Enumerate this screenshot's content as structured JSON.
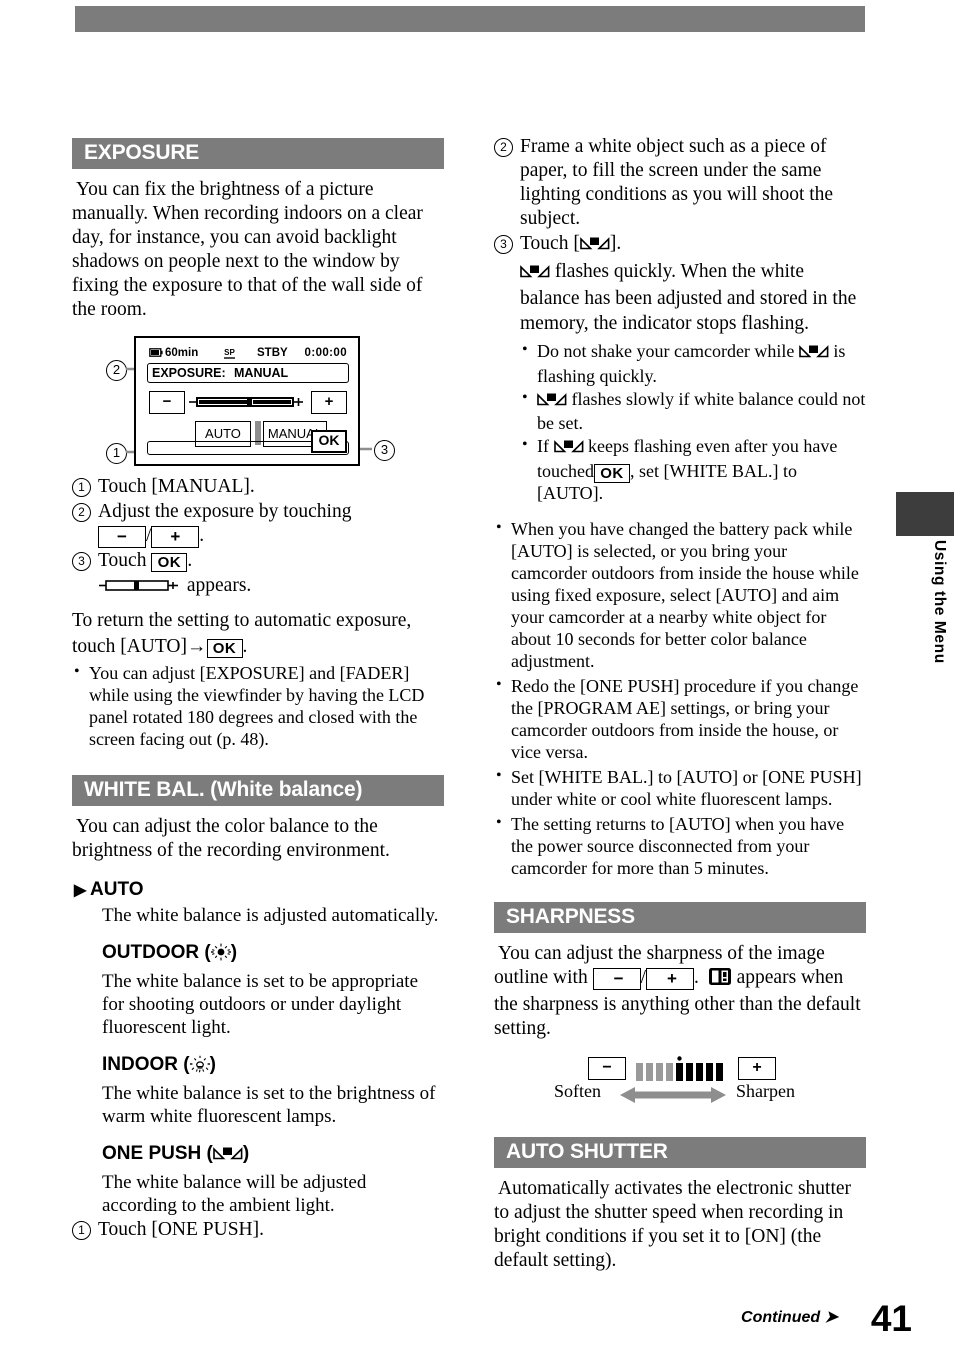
{
  "page": {
    "number": "41",
    "continued_label": "Continued",
    "side_tab_label": "Using the Menu"
  },
  "sections": {
    "exposure": {
      "heading": "EXPOSURE",
      "intro": "You can fix the brightness of a picture manually. When recording indoors on a clear day, for instance, you can avoid backlight shadows on people next to the window by fixing the exposure to that of the wall side of the room.",
      "steps": [
        {
          "num": "1",
          "text_before": "Touch [MANUAL].",
          "text_after": ""
        },
        {
          "num": "2",
          "text_before": "Adjust the exposure by touching",
          "text_after": "."
        },
        {
          "num": "3",
          "text_before": "Touch",
          "text_after": "."
        }
      ],
      "appears_text": "appears.",
      "return_text_1": "To return the setting to automatic exposure,",
      "return_text_2a": "touch [AUTO]",
      "return_text_2b": ".",
      "bullets": [
        "You can adjust [EXPOSURE] and [FADER] while using the viewfinder by having the LCD panel rotated 180 degrees and closed with the screen facing out (p. 48)."
      ]
    },
    "white_balance": {
      "heading": "WHITE BAL. (White balance)",
      "intro": "You can adjust the color balance to the brightness of the recording environment.",
      "options": [
        {
          "label": "AUTO",
          "icon": "",
          "marker": "default-arrow",
          "desc": "The white balance is adjusted automatically."
        },
        {
          "label": "OUTDOOR",
          "icon": "sun-icon",
          "marker": "",
          "desc": "The white balance is set to be appropriate for shooting outdoors or under daylight fluorescent light."
        },
        {
          "label": "INDOOR",
          "icon": "bulb-icon",
          "marker": "",
          "desc": "The white balance is set to the brightness of warm white fluorescent lamps."
        },
        {
          "label": "ONE PUSH",
          "icon": "one-push-icon",
          "marker": "",
          "desc": "The white balance will be adjusted according to the ambient light."
        }
      ],
      "one_push_steps": [
        {
          "num": "1",
          "text": "Touch [ONE PUSH]."
        },
        {
          "num": "2",
          "text": "Frame a white object such as a piece of paper, to fill the screen under the same lighting conditions as you will shoot the subject."
        },
        {
          "num": "3",
          "text_before": "Touch [",
          "text_after": "]."
        }
      ],
      "one_push_detail": "flashes quickly. When the white balance has been adjusted and stored in the memory, the indicator stops flashing.",
      "inner_bullets": [
        {
          "pre": "Do not shake your camcorder while",
          "post": "is flashing quickly.",
          "icon_pos": "middle"
        },
        {
          "pre": "",
          "post": "flashes slowly if white balance could not be set.",
          "icon_pos": "start"
        },
        {
          "pre": "If",
          "mid": "keeps flashing even after you have touched",
          "post": ", set [WHITE BAL.] to [AUTO].",
          "icon_pos": "after-if"
        }
      ],
      "outer_bullets": [
        "When you have changed the battery pack while [AUTO] is selected, or you bring your camcorder outdoors from inside the house while using fixed exposure, select [AUTO] and aim your camcorder at a nearby white object for about 10 seconds for better color balance adjustment.",
        "Redo the [ONE PUSH] procedure if you change the [PROGRAM AE] settings, or bring your camcorder outdoors from inside the house, or vice versa.",
        "Set [WHITE BAL.] to [AUTO] or [ONE PUSH] under white or cool white fluorescent lamps.",
        "The setting returns to [AUTO] when you have the power source disconnected from your camcorder for more than 5 minutes."
      ]
    },
    "sharpness": {
      "heading": "SHARPNESS",
      "text_part1": "You can adjust the sharpness of the image outline with",
      "text_part2": ".",
      "text_part3": "appears when the sharpness is anything other than the default setting.",
      "scale": {
        "minus_label": "−",
        "plus_label": "+",
        "left_label": "Soften",
        "right_label": "Sharpen",
        "total_segments": 9,
        "filled_segments": 4,
        "marker_segment": 5
      }
    },
    "auto_shutter": {
      "heading": "AUTO SHUTTER",
      "text": "Automatically activates the electronic shutter to adjust the shutter speed when recording in bright conditions if you set it to [ON] (the default setting)."
    }
  },
  "diagram": {
    "status_bar": {
      "battery_icon": "battery-icon",
      "battery_time": "60min",
      "rec_mode_icon": "sp-mode-icon",
      "status": "STBY",
      "timecode": "0:00:00"
    },
    "exposure_row": {
      "label": "EXPOSURE:",
      "value": "MANUAL"
    },
    "minus_key": "−",
    "plus_key": "+",
    "auto_button": "AUTO",
    "manual_button": "MANUAL",
    "ok_button": "OK",
    "callouts": {
      "one": "1",
      "two": "2",
      "three": "3"
    }
  },
  "colors": {
    "heading_bar": "#7c7c7c",
    "side_tab": "#3d3d3d",
    "text": "#000000",
    "page_bg": "#ffffff"
  }
}
